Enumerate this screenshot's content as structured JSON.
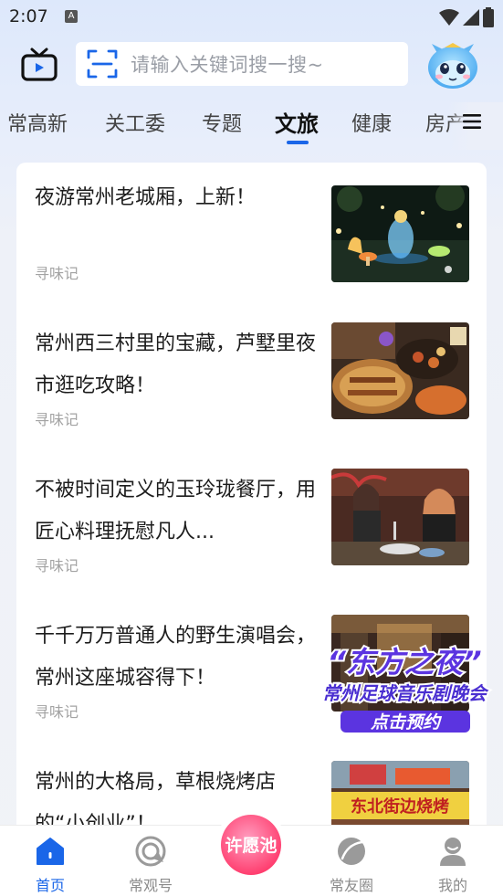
{
  "status_bar": {
    "time": "2:07",
    "notification_glyph": "A"
  },
  "header": {
    "tv_icon": "tv-icon",
    "search_placeholder": "请输入关键词搜一搜~",
    "mascot_icon": "mascot-avatar"
  },
  "tabs": {
    "items": [
      "常高新",
      "关工委",
      "专题",
      "文旅",
      "健康",
      "房产"
    ],
    "active_index": 3
  },
  "feed": {
    "articles": [
      {
        "title": "夜游常州老城厢，上新！",
        "source": "寻味记"
      },
      {
        "title": "常州西三村里的宝藏，芦墅里夜市逛吃攻略！",
        "source": "寻味记"
      },
      {
        "title": "不被时间定义的玉玲珑餐厅，用匠心料理抚慰凡人...",
        "source": "寻味记"
      },
      {
        "title": "千千万万普通人的野生演唱会，常州这座城容得下！",
        "source": "寻味记"
      },
      {
        "title": "常州的大格局，草根烧烤店的“小创业”！",
        "source": ""
      }
    ],
    "thumb5_sign": "东北街边烧烤"
  },
  "promo": {
    "title": "“东方之夜”",
    "subtitle": "常州足球音乐剧晚会",
    "button": "点击预约"
  },
  "bottom_nav": {
    "items": [
      {
        "label": "首页",
        "icon": "home-icon",
        "active": true
      },
      {
        "label": "常观号",
        "icon": "channel-icon",
        "active": false
      },
      {
        "label": "许愿池",
        "icon": "wish-pool-icon",
        "active": false
      },
      {
        "label": "常友圈",
        "icon": "friends-circle-icon",
        "active": false
      },
      {
        "label": "我的",
        "icon": "profile-icon",
        "active": false
      }
    ]
  },
  "colors": {
    "accent": "#1a66e8",
    "promo_purple": "#4a2fd1"
  }
}
